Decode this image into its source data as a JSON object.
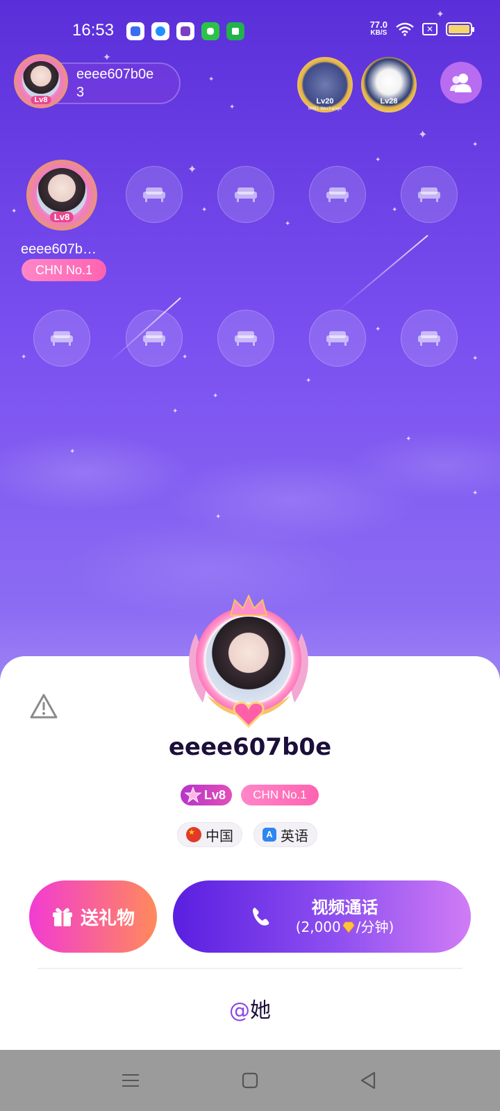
{
  "status_bar": {
    "time": "16:53",
    "net_speed_value": "77.0",
    "net_speed_unit": "KB/S",
    "apps": [
      "baidu-app-icon",
      "player-app-icon",
      "tv-app-icon",
      "green-app-icon",
      "shield-app-icon"
    ],
    "battery_level": 1.0
  },
  "room": {
    "host_name_line1": "eeee607b0e",
    "host_name_line2": "3",
    "host_level": "Lv8",
    "top_badges": [
      {
        "level": "Lv20",
        "sub": "WIN1 Wechange"
      },
      {
        "level": "Lv28",
        "sub": ""
      }
    ],
    "seated_host_name": "eeee607b…",
    "seated_host_badge": "CHN No.1",
    "empty_seat_icon": "sofa-icon"
  },
  "profile_card": {
    "name": "eeee607b0e",
    "level": "Lv8",
    "rank_badge": "CHN No.1",
    "country": "中国",
    "language": "英语",
    "gift_button": "送礼物",
    "call_button_title": "视频通话",
    "call_price_prefix": "(2,000",
    "call_price_suffix": "/分钟)",
    "mention_at": "@",
    "mention_label": "她"
  },
  "colors": {
    "background_top": "#5a2fd9",
    "background_bottom": "#7c5cf0",
    "gift_gradient_start": "#f23bd3",
    "gift_gradient_end": "#ff8a5b",
    "call_gradient_start": "#5a1fe0",
    "call_gradient_end": "#d07cf5",
    "mention_accent": "#8b45e6",
    "navbar": "#9b9b9b"
  }
}
